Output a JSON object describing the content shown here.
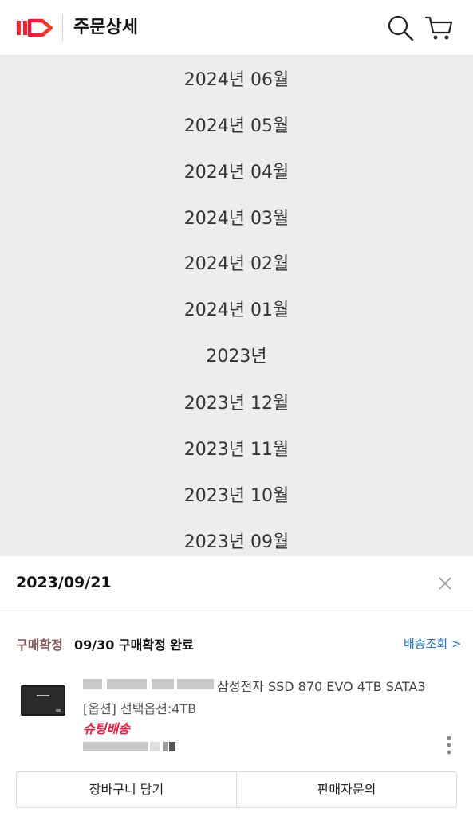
{
  "header": {
    "logo_text": "11",
    "title": "주문상세",
    "search_icon": "search-icon",
    "cart_icon": "cart-icon"
  },
  "month_list": [
    "2024년 06월",
    "2024년 05월",
    "2024년 04월",
    "2024년 03월",
    "2024년 02월",
    "2024년 01월",
    "2023년",
    "2023년 12월",
    "2023년 11월",
    "2023년 10월",
    "2023년 09월"
  ],
  "order": {
    "date": "2023/09/21",
    "status_label": "구매확정",
    "status_text": "09/30 구매확정 완료",
    "tracking_link": "배송조회 >",
    "product_name": "삼성전자 SSD 870 EVO 4TB SATA3",
    "product_option": "[옵션] 선택옵션:4TB",
    "delivery_badge": "슈팅배송",
    "buttons": {
      "cart": "장바구니 담기",
      "seller_inquiry": "판매자문의"
    }
  },
  "colors": {
    "brand_red": "#ff1a3c",
    "link_blue": "#1a73e8",
    "status_brown": "#8a5a5a",
    "list_bg": "#ededed"
  }
}
